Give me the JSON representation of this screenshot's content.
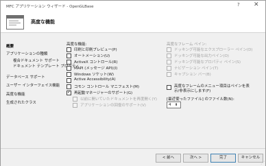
{
  "window": {
    "title": "MFC アプリケーション ウィザード - OpenGLBase",
    "help": "?",
    "close": "✕"
  },
  "header": {
    "title": "高度な機能"
  },
  "nav": [
    {
      "label": "概要",
      "active": true
    },
    {
      "label": "アプリケーションの種類",
      "active": false
    },
    {
      "label": "複合ドキュメント サポート",
      "active": false
    },
    {
      "label": "ドキュメント テンプレート プロパティ",
      "active": false
    },
    {
      "label": "データベース サポート",
      "active": false
    },
    {
      "label": "ユーザー インターフェイス機能",
      "active": false
    },
    {
      "label": "高度な機能",
      "active": false
    },
    {
      "label": "生成されたクラス",
      "active": false
    }
  ],
  "features": {
    "title": "高度な機能:",
    "options": [
      {
        "label": "印刷と印刷プレビュー(P)",
        "checked": false,
        "enabled": true
      },
      {
        "label": "オートメーション(U)",
        "checked": false,
        "enabled": true
      },
      {
        "label": "ActiveX コントロール(R)",
        "checked": false,
        "enabled": true
      },
      {
        "label": "MAPI (メッセージ API)(I)",
        "checked": false,
        "enabled": true
      },
      {
        "label": "Windows ソケット(W)",
        "checked": false,
        "enabled": true
      },
      {
        "label": "Active Accessibility(A)",
        "checked": false,
        "enabled": true
      },
      {
        "label": "コモン コントロール マニフェスト(M)",
        "checked": false,
        "enabled": true
      },
      {
        "label": "再起動マネージャーのサポート(G)",
        "checked": true,
        "enabled": true
      },
      {
        "label": "以前に開いていたドキュメントを再度開く(Y)",
        "checked": false,
        "enabled": false
      },
      {
        "label": "アプリケーションの回復のサポート(V)",
        "checked": false,
        "enabled": false
      }
    ]
  },
  "frame_panes": {
    "title": "高度なフレーム ペイン:",
    "options": [
      {
        "label": "ドッキング可能なエクスプローラー ペイン(D)",
        "enabled": false
      },
      {
        "label": "ドッキング可能な出力ペイン(O)",
        "enabled": false
      },
      {
        "label": "ドッキング可能なプロパティ ペイン(S)",
        "enabled": false
      },
      {
        "label": "ナビゲーション ペイン(T)",
        "enabled": false
      },
      {
        "label": "キャプション バー(B)",
        "enabled": false
      }
    ]
  },
  "menu_option": {
    "label": "高度なフレームのメニュー項目はペインを表示/非表示にします(F)",
    "checked": false
  },
  "mru": {
    "label": "[最近使ったファイル] のファイル数(N):",
    "value": "4"
  },
  "buttons": {
    "back": "< 前へ",
    "next": "次へ >",
    "finish": "完了",
    "cancel": "キャンセル"
  }
}
